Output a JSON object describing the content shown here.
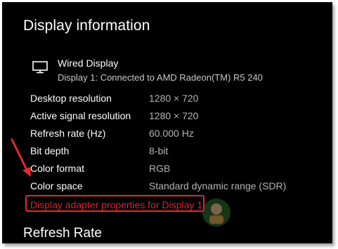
{
  "header": {
    "title": "Display information"
  },
  "display": {
    "name": "Wired Display",
    "subtitle": "Display 1: Connected to AMD Radeon(TM) R5 240",
    "icon": "monitor-icon"
  },
  "properties": [
    {
      "label": "Desktop resolution",
      "value": "1280 × 720"
    },
    {
      "label": "Active signal resolution",
      "value": "1280 × 720"
    },
    {
      "label": "Refresh rate (Hz)",
      "value": "60.000 Hz"
    },
    {
      "label": "Bit depth",
      "value": "8-bit"
    },
    {
      "label": "Color format",
      "value": "RGB"
    },
    {
      "label": "Color space",
      "value": "Standard dynamic range (SDR)"
    }
  ],
  "adapter_link": {
    "label": "Display adapter properties for Display 1"
  },
  "refresh_section": {
    "title": "Refresh Rate"
  },
  "colors": {
    "background": "#000000",
    "link": "#d8262b",
    "annotation": "#e5282f",
    "value_text": "#b4b4b4"
  }
}
